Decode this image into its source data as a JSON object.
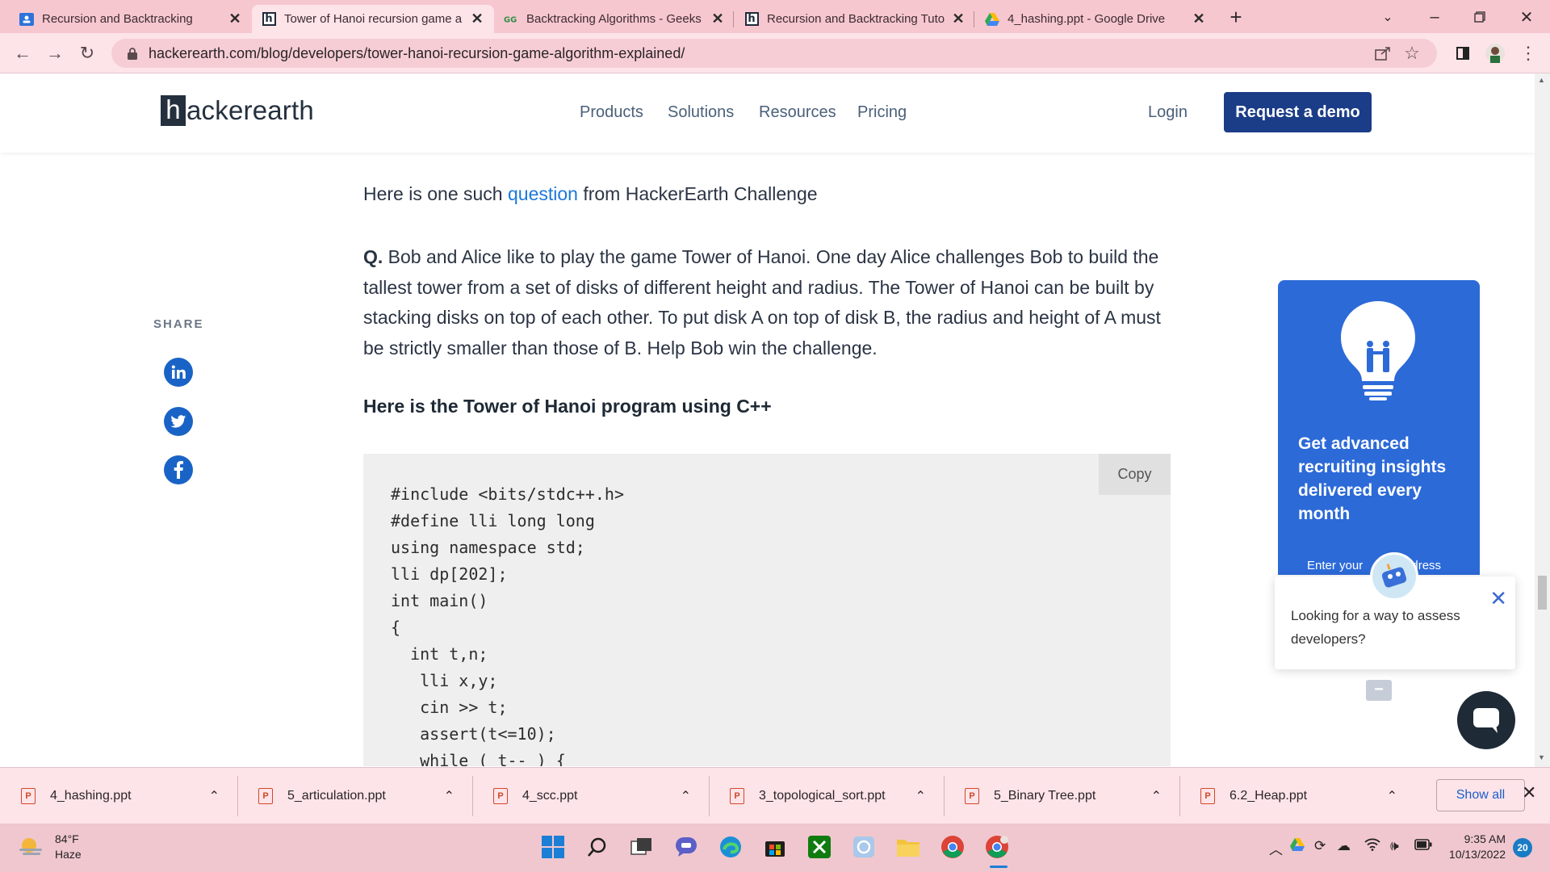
{
  "browser": {
    "tabs": [
      {
        "title": "Recursion and Backtracking",
        "active": false
      },
      {
        "title": "Tower of Hanoi recursion game a",
        "active": true
      },
      {
        "title": "Backtracking Algorithms - Geeks",
        "active": false
      },
      {
        "title": "Recursion and Backtracking Tuto",
        "active": false
      },
      {
        "title": "4_hashing.ppt - Google Drive",
        "active": false
      }
    ],
    "new_tab": "+",
    "url": "hackerearth.com/blog/developers/tower-hanoi-recursion-game-algorithm-explained/"
  },
  "site": {
    "logo_mark": "h",
    "logo_text": "ackerearth",
    "nav": [
      "Products",
      "Solutions",
      "Resources",
      "Pricing"
    ],
    "login": "Login",
    "cta": "Request a demo"
  },
  "article": {
    "intro_before": "Here is one such ",
    "intro_link": "question",
    "intro_after": " from HackerEarth Challenge",
    "question_prefix": "Q.",
    "question_text": " Bob and Alice like to play the game Tower of Hanoi. One day Alice challenges Bob to build the tallest tower from a set of disks of different height and radius. The Tower of Hanoi can be built by stacking disks on top of each other. To put disk A on top of disk B, the radius and height of A must be strictly smaller than those of B. Help Bob win the challenge.",
    "subheading": "Here is the Tower of Hanoi program using C++",
    "copy_label": "Copy",
    "code_lines": [
      "#include <bits/stdc++.h>",
      "#define lli long long",
      "using namespace std;",
      "lli dp[202];",
      "int main()",
      "{",
      "  int t,n;",
      "   lli x,y;",
      "   cin >> t;",
      "   assert(t<=10);",
      "   while ( t-- ) {"
    ]
  },
  "share": {
    "label": "SHARE",
    "icons": [
      "linkedin-icon",
      "twitter-icon",
      "facebook-icon"
    ]
  },
  "promo": {
    "heading": "Get advanced recruiting insights delivered every month",
    "email_placeholder_start": "Enter your ",
    "email_placeholder_end": "dress"
  },
  "chat": {
    "message": "Looking for a way to assess developers?",
    "minimize": "−"
  },
  "downloads": {
    "items": [
      "4_hashing.ppt",
      "5_articulation.ppt",
      "4_scc.ppt",
      "3_topological_sort.ppt",
      "5_Binary Tree.ppt",
      "6.2_Heap.ppt"
    ],
    "show_all": "Show all"
  },
  "taskbar": {
    "temperature": "84°F",
    "condition": "Haze",
    "time": "9:35 AM",
    "date": "10/13/2022",
    "notifications": "20"
  },
  "colors": {
    "brand_navy": "#1b3c87",
    "link_blue": "#1b78d8",
    "promo_blue": "#2c6ad8",
    "chrome_pink": "#f7c7d0"
  }
}
